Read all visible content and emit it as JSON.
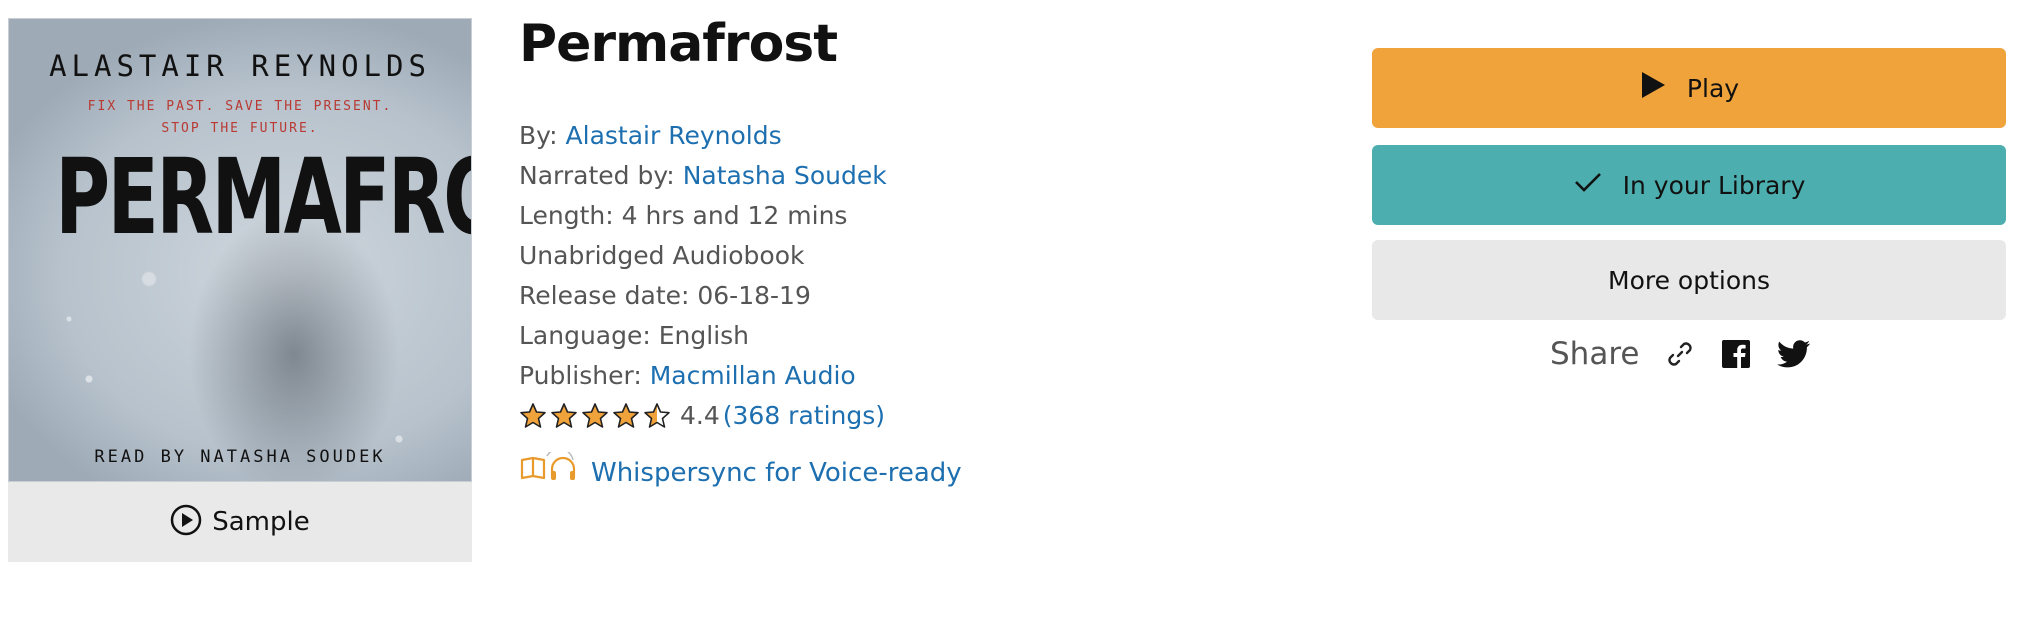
{
  "cover": {
    "author": "ALASTAIR REYNOLDS",
    "tagline_1": "FIX THE PAST. SAVE THE PRESENT.",
    "tagline_2": "STOP THE FUTURE.",
    "title": "PERMAFROST",
    "reader": "READ BY NATASHA SOUDEK"
  },
  "sample": {
    "label": "Sample",
    "icon": "play-circle-icon"
  },
  "book": {
    "title": "Permafrost",
    "by_label": "By:",
    "author": "Alastair Reynolds",
    "narrated_label": "Narrated by:",
    "narrator": "Natasha Soudek",
    "length": "Length: 4 hrs and 12 mins",
    "format": "Unabridged Audiobook",
    "release": "Release date: 06-18-19",
    "language": "Language: English",
    "publisher_label": "Publisher:",
    "publisher": "Macmillan Audio",
    "rating_value": "4.4",
    "rating_count": "(368 ratings)",
    "stars": 4.5,
    "whispersync": "Whispersync for Voice-ready"
  },
  "actions": {
    "play": "Play",
    "library": "In your Library",
    "more": "More options"
  },
  "share": {
    "label": "Share",
    "icons": [
      "link-icon",
      "facebook-icon",
      "twitter-icon"
    ]
  },
  "colors": {
    "play": "#f0a33a",
    "library": "#4caeae",
    "more": "#e8e8e8",
    "link": "#1d6fb0",
    "star": "#f0a33a"
  }
}
